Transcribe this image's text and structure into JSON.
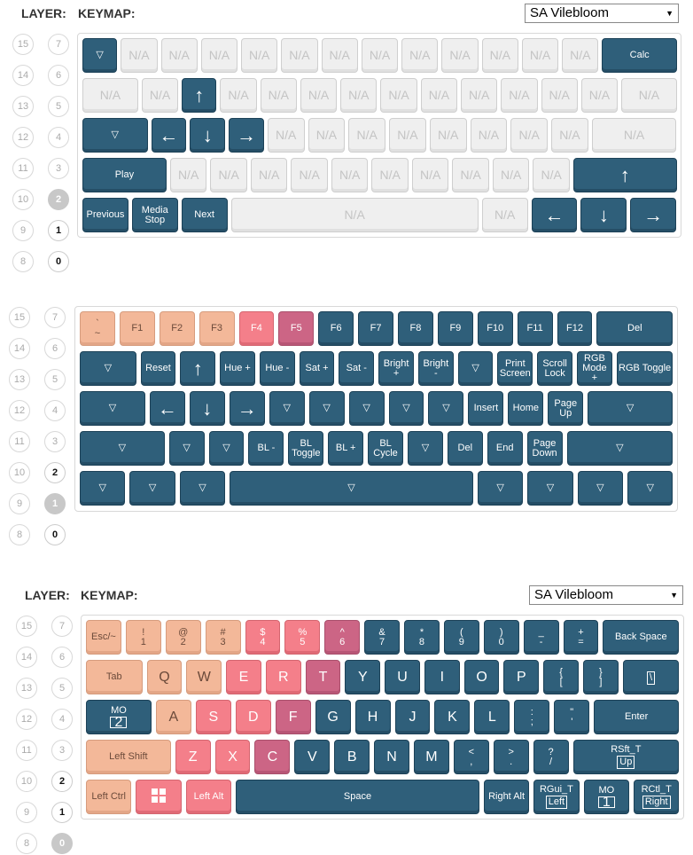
{
  "header_top": {
    "layer_label": "LAYER:",
    "keymap_label": "KEYMAP:",
    "select_value": "SA Vilebloom"
  },
  "header_bottom": {
    "layer_label": "LAYER:",
    "keymap_label": "KEYMAP:",
    "select_value": "SA Vilebloom"
  },
  "layer_numbers": {
    "left": [
      "15",
      "14",
      "13",
      "12",
      "11",
      "10",
      "9",
      "8"
    ],
    "right": [
      "7",
      "6",
      "5",
      "4",
      "3",
      "2",
      "1",
      "0"
    ]
  },
  "icons": {
    "windows": "windows-icon",
    "arrow": "arrow-icon",
    "transparent": "transparent-key-icon"
  },
  "colors": {
    "dark_key": "#2f5f7a",
    "na_key": "#efefef",
    "peach_key": "#f3b899",
    "red_key": "#f47f8a",
    "magenta_key": "#cc6585"
  },
  "kb1": {
    "rows": [
      [
        [
          "d",
          "▽"
        ],
        [
          "na",
          "N/A"
        ],
        [
          "na",
          "N/A"
        ],
        [
          "na",
          "N/A"
        ],
        [
          "na",
          "N/A"
        ],
        [
          "na",
          "N/A"
        ],
        [
          "na",
          "N/A"
        ],
        [
          "na",
          "N/A"
        ],
        [
          "na",
          "N/A"
        ],
        [
          "na",
          "N/A"
        ],
        [
          "na",
          "N/A"
        ],
        [
          "na",
          "N/A"
        ],
        [
          "na",
          "N/A"
        ],
        [
          "d",
          "Calc"
        ]
      ],
      [
        [
          "na",
          "N/A"
        ],
        [
          "na",
          "N/A"
        ],
        [
          "d",
          "↑"
        ],
        [
          "na",
          "N/A"
        ],
        [
          "na",
          "N/A"
        ],
        [
          "na",
          "N/A"
        ],
        [
          "na",
          "N/A"
        ],
        [
          "na",
          "N/A"
        ],
        [
          "na",
          "N/A"
        ],
        [
          "na",
          "N/A"
        ],
        [
          "na",
          "N/A"
        ],
        [
          "na",
          "N/A"
        ],
        [
          "na",
          "N/A"
        ],
        [
          "na",
          "N/A"
        ]
      ],
      [
        [
          "d",
          "▽"
        ],
        [
          "d",
          "←"
        ],
        [
          "d",
          "↓"
        ],
        [
          "d",
          "→"
        ],
        [
          "na",
          "N/A"
        ],
        [
          "na",
          "N/A"
        ],
        [
          "na",
          "N/A"
        ],
        [
          "na",
          "N/A"
        ],
        [
          "na",
          "N/A"
        ],
        [
          "na",
          "N/A"
        ],
        [
          "na",
          "N/A"
        ],
        [
          "na",
          "N/A"
        ],
        [
          "na",
          "N/A"
        ]
      ],
      [
        [
          "d",
          "Play"
        ],
        [
          "na",
          "N/A"
        ],
        [
          "na",
          "N/A"
        ],
        [
          "na",
          "N/A"
        ],
        [
          "na",
          "N/A"
        ],
        [
          "na",
          "N/A"
        ],
        [
          "na",
          "N/A"
        ],
        [
          "na",
          "N/A"
        ],
        [
          "na",
          "N/A"
        ],
        [
          "na",
          "N/A"
        ],
        [
          "na",
          "N/A"
        ],
        [
          "d",
          "↑"
        ]
      ],
      [
        [
          "d",
          "Previous"
        ],
        [
          "d",
          "Media\nStop"
        ],
        [
          "d",
          "Next"
        ],
        [
          "na",
          "N/A"
        ],
        [
          "na",
          "N/A"
        ],
        [
          "d",
          "←"
        ],
        [
          "d",
          "↓"
        ],
        [
          "d",
          "→"
        ]
      ]
    ]
  },
  "kb2": {
    "rows": [
      [
        [
          "p",
          "`\n~"
        ],
        [
          "p",
          "F1"
        ],
        [
          "p",
          "F2"
        ],
        [
          "p",
          "F3"
        ],
        [
          "r",
          "F4"
        ],
        [
          "m",
          "F5"
        ],
        [
          "d",
          "F6"
        ],
        [
          "d",
          "F7"
        ],
        [
          "d",
          "F8"
        ],
        [
          "d",
          "F9"
        ],
        [
          "d",
          "F10"
        ],
        [
          "d",
          "F11"
        ],
        [
          "d",
          "F12"
        ],
        [
          "d",
          "Del"
        ]
      ],
      [
        [
          "d",
          "▽"
        ],
        [
          "d",
          "Reset"
        ],
        [
          "d",
          "↑"
        ],
        [
          "d",
          "Hue +"
        ],
        [
          "d",
          "Hue -"
        ],
        [
          "d",
          "Sat +"
        ],
        [
          "d",
          "Sat -"
        ],
        [
          "d",
          "Bright\n+"
        ],
        [
          "d",
          "Bright\n-"
        ],
        [
          "d",
          "▽"
        ],
        [
          "d",
          "Print\nScreen"
        ],
        [
          "d",
          "Scroll\nLock"
        ],
        [
          "d",
          "RGB\nMode\n+"
        ],
        [
          "d",
          "RGB Toggle"
        ]
      ],
      [
        [
          "d",
          "▽"
        ],
        [
          "d",
          "←"
        ],
        [
          "d",
          "↓"
        ],
        [
          "d",
          "→"
        ],
        [
          "d",
          "▽"
        ],
        [
          "d",
          "▽"
        ],
        [
          "d",
          "▽"
        ],
        [
          "d",
          "▽"
        ],
        [
          "d",
          "▽"
        ],
        [
          "d",
          "Insert"
        ],
        [
          "d",
          "Home"
        ],
        [
          "d",
          "Page\nUp"
        ],
        [
          "d",
          "▽"
        ]
      ],
      [
        [
          "d",
          "▽"
        ],
        [
          "d",
          "▽"
        ],
        [
          "d",
          "▽"
        ],
        [
          "d",
          "BL -"
        ],
        [
          "d",
          "BL\nToggle"
        ],
        [
          "d",
          "BL +"
        ],
        [
          "d",
          "BL\nCycle"
        ],
        [
          "d",
          "▽"
        ],
        [
          "d",
          "Del"
        ],
        [
          "d",
          "End"
        ],
        [
          "d",
          "Page\nDown"
        ],
        [
          "d",
          "▽"
        ]
      ],
      [
        [
          "d",
          "▽"
        ],
        [
          "d",
          "▽"
        ],
        [
          "d",
          "▽"
        ],
        [
          "d",
          "▽"
        ],
        [
          "d",
          "▽"
        ],
        [
          "d",
          "▽"
        ],
        [
          "d",
          "▽"
        ],
        [
          "d",
          "▽"
        ]
      ]
    ]
  },
  "kb3": {
    "rows": [
      [
        [
          "p",
          "Esc/~"
        ],
        [
          "p",
          "!\n1"
        ],
        [
          "p",
          "@\n2"
        ],
        [
          "p",
          "#\n3"
        ],
        [
          "r",
          "$\n4"
        ],
        [
          "r",
          "%\n5"
        ],
        [
          "m",
          "^\n6"
        ],
        [
          "d",
          "&\n7"
        ],
        [
          "d",
          "*\n8"
        ],
        [
          "d",
          "(\n9"
        ],
        [
          "d",
          ")\n0"
        ],
        [
          "d",
          "_\n-"
        ],
        [
          "d",
          "+\n="
        ],
        [
          "d",
          "Back Space"
        ]
      ],
      [
        [
          "p",
          "Tab"
        ],
        [
          "p",
          "Q"
        ],
        [
          "p",
          "W"
        ],
        [
          "r",
          "E"
        ],
        [
          "r",
          "R"
        ],
        [
          "m",
          "T"
        ],
        [
          "d",
          "Y"
        ],
        [
          "d",
          "U"
        ],
        [
          "d",
          "I"
        ],
        [
          "d",
          "O"
        ],
        [
          "d",
          "P"
        ],
        [
          "d",
          "{\n["
        ],
        [
          "d",
          "}\n]"
        ],
        [
          "d",
          "|\n\\"
        ]
      ],
      [
        [
          "d",
          "MO|2"
        ],
        [
          "p",
          "A"
        ],
        [
          "r",
          "S"
        ],
        [
          "r",
          "D"
        ],
        [
          "m",
          "F"
        ],
        [
          "d",
          "G"
        ],
        [
          "d",
          "H"
        ],
        [
          "d",
          "J"
        ],
        [
          "d",
          "K"
        ],
        [
          "d",
          "L"
        ],
        [
          "d",
          ":\n;"
        ],
        [
          "d",
          "\"\n'"
        ],
        [
          "d",
          "Enter"
        ]
      ],
      [
        [
          "p",
          "Left Shift"
        ],
        [
          "r",
          "Z"
        ],
        [
          "r",
          "X"
        ],
        [
          "m",
          "C"
        ],
        [
          "d",
          "V"
        ],
        [
          "d",
          "B"
        ],
        [
          "d",
          "N"
        ],
        [
          "d",
          "M"
        ],
        [
          "d",
          "<\n,"
        ],
        [
          "d",
          ">\n."
        ],
        [
          "d",
          "?\n/"
        ],
        [
          "d",
          "RSft_T|Up"
        ]
      ],
      [
        [
          "p",
          "Left Ctrl"
        ],
        [
          "r",
          "WIN"
        ],
        [
          "r",
          "Left Alt"
        ],
        [
          "d",
          "Space"
        ],
        [
          "d",
          "Right Alt"
        ],
        [
          "d",
          "RGui_T|Left"
        ],
        [
          "d",
          "MO|1"
        ],
        [
          "d",
          "RCtl_T|Right"
        ]
      ]
    ]
  }
}
